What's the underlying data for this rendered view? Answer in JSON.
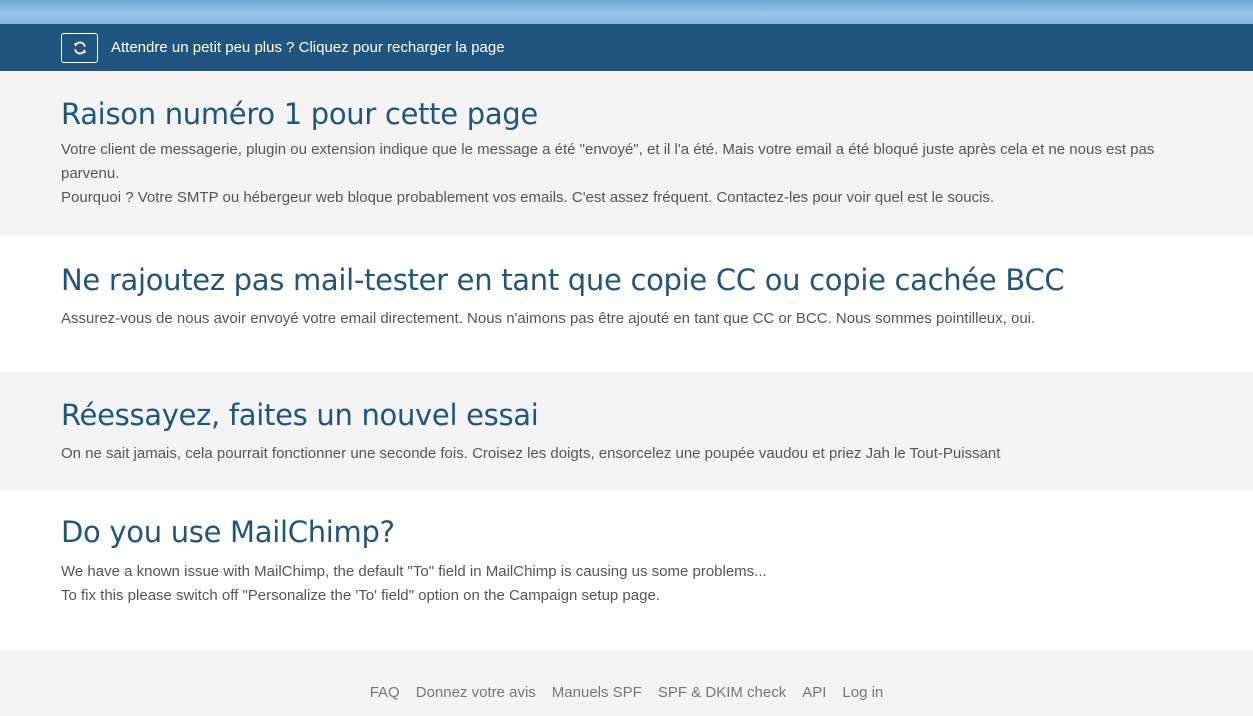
{
  "reload_bar": {
    "icon": "refresh-icon",
    "text": "Attendre un petit peu plus ? Cliquez pour recharger la page"
  },
  "sections": [
    {
      "title": "Raison numéro 1 pour cette page",
      "lines": [
        "Votre client de messagerie, plugin ou extension indique que le message a été \"envoyé\", et il l'a été. Mais votre email a été bloqué juste après cela et ne nous est pas parvenu.",
        "Pourquoi ? Votre SMTP ou hébergeur web bloque probablement vos emails. C'est assez fréquent. Contactez-les pour voir quel est le soucis."
      ]
    },
    {
      "title": "Ne rajoutez pas mail-tester en tant que copie CC ou copie cachée BCC",
      "lines": [
        "Assurez-vous de nous avoir envoyé votre email directement. Nous n'aimons pas être ajouté en tant que CC or BCC. Nous sommes pointilleux, oui."
      ]
    },
    {
      "title": "Réessayez, faites un nouvel essai",
      "lines": [
        "On ne sait jamais, cela pourrait fonctionner une seconde fois. Croisez les doigts, ensorcelez une poupée vaudou et priez Jah le Tout-Puissant"
      ]
    },
    {
      "title": "Do you use MailChimp?",
      "lines": [
        "We have a known issue with MailChimp, the default \"To\" field in MailChimp is causing us some problems...",
        "To fix this please switch off \"Personalize the 'To' field\" option on the Campaign setup page."
      ]
    }
  ],
  "footer": {
    "links": [
      "FAQ",
      "Donnez votre avis",
      "Manuels SPF",
      "SPF & DKIM check",
      "API",
      "Log in"
    ]
  },
  "colors": {
    "bar": "#225480",
    "heading": "#225480",
    "body_text": "#555555"
  }
}
